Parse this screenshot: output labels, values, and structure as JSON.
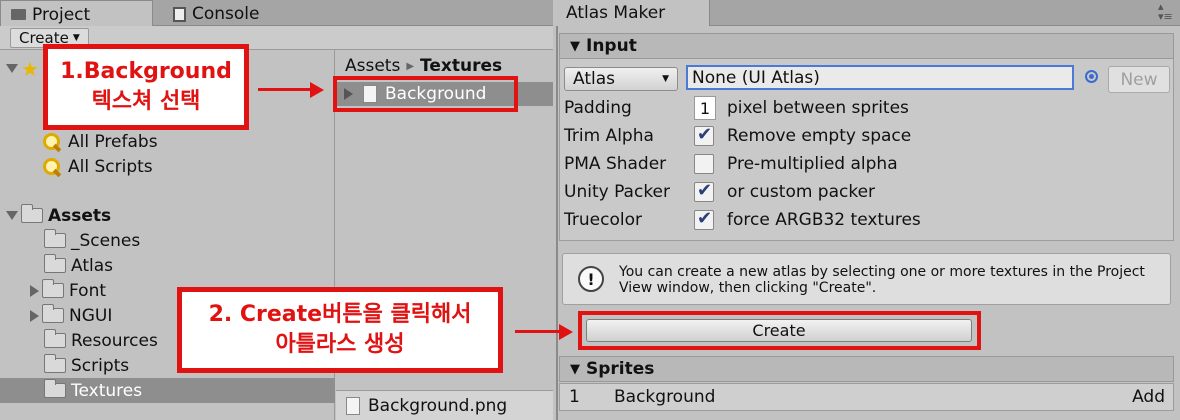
{
  "left_window": {
    "tabs": [
      {
        "label": "Project",
        "icon": "folder-tab-icon"
      },
      {
        "label": "Console",
        "icon": "console-icon"
      }
    ],
    "create_label": "Create",
    "favorites": [
      "All Prefabs",
      "All Scripts"
    ],
    "assets_root": "Assets",
    "asset_folders": [
      "_Scenes",
      "Atlas",
      "Font",
      "NGUI",
      "Resources",
      "Scripts",
      "Textures"
    ],
    "breadcrumb": [
      "Assets",
      "Textures"
    ],
    "asset_item": "Background",
    "status_file": "Background.png"
  },
  "atlas_maker": {
    "tab_title": "Atlas Maker",
    "input_header": "Input",
    "atlas_popup": "Atlas",
    "atlas_field_value": "None (UI Atlas)",
    "new_button": "New",
    "padding_label": "Padding",
    "padding_value": "1",
    "padding_suffix": "pixel between sprites",
    "options": [
      {
        "label": "Trim Alpha",
        "checked": true,
        "text": "Remove empty space"
      },
      {
        "label": "PMA Shader",
        "checked": false,
        "text": "Pre-multiplied alpha"
      },
      {
        "label": "Unity Packer",
        "checked": true,
        "text": "or custom packer"
      },
      {
        "label": "Truecolor",
        "checked": true,
        "text": "force ARGB32 textures"
      }
    ],
    "help_text": "You can create a new atlas by selecting one or more textures in the Project View window, then clicking \"Create\".",
    "create_button": "Create",
    "sprites_header": "Sprites",
    "sprites": [
      {
        "index": "1",
        "name": "Background",
        "action": "Add"
      }
    ]
  },
  "annotations": {
    "step1": {
      "line1": "1.Background",
      "line2": "텍스쳐 선택"
    },
    "step2": {
      "line1": "2. Create버튼을 클릭해서",
      "line2": "아틀라스 생성"
    }
  },
  "colors": {
    "annotation_red": "#e01212",
    "selection_gray": "#8e8e8e",
    "focus_blue": "#4a79d6"
  }
}
